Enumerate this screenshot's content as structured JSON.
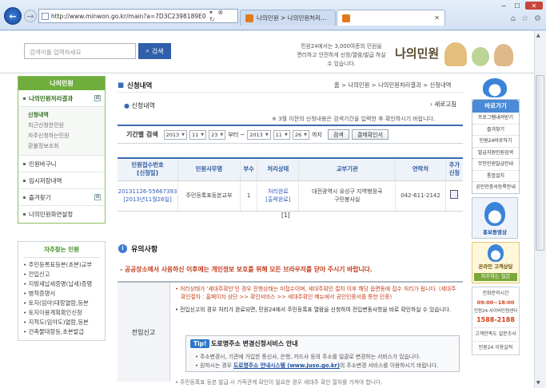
{
  "browser": {
    "url": "http://www.minwon.go.kr/main?a=7D3C2398189E0",
    "tab1": "나의민원 > 나의민원처리...",
    "tab2": "",
    "address_controls": "▾ ⊗ ↻"
  },
  "header": {
    "search_placeholder": "검색어를 입력하세요",
    "search_button": "검색",
    "promo_line1": "민원24에서는 3,000여종의 민원을",
    "promo_line2": "편리하고 안전하게 신청/열람/발급 하실 수 있습니다.",
    "logo": "나의민원"
  },
  "left_nav": {
    "title": "나의민원",
    "items": [
      {
        "label": "나의민원처리결과",
        "toggle": "⊟"
      },
      {
        "label": "민원바구니"
      },
      {
        "label": "임시저장내역"
      },
      {
        "label": "즐겨찾기",
        "toggle": "⊞"
      },
      {
        "label": "나의민원화면설정"
      }
    ],
    "sub_items": [
      "신청내역",
      "최근신청한민원",
      "자주신청하는민원",
      "환불정보조회"
    ]
  },
  "favorites": {
    "title": "자주찾는 민원",
    "items": [
      "주민등록표등본(초본)교부",
      "전입신고",
      "지방세납세증명(납세)증명",
      "병적증명서",
      "토지(임야)대장열람,등본",
      "토지이용계획확인신청",
      "지적도(임야도)열람,등본",
      "건축물대장등,초본발급"
    ]
  },
  "main": {
    "title": "신청내역",
    "breadcrumb": "홈 > 나의민원 > 나의민원처리결과 > 신청내역",
    "subtitle": "신청내역",
    "print": "새로고침",
    "note": "※ 3월 이전의 신청내용은 검색기간을 입력한 후 확인하시기 바랍니다.",
    "filter": {
      "label": "기간별 검색",
      "from_year": "2013",
      "from_month": "11",
      "from_day": "23",
      "sep1": "부터 ~",
      "to_year": "2013",
      "to_month": "11",
      "to_day": "26",
      "sep2": "까지",
      "search_button": "검색",
      "pay_button": "결제확인서"
    },
    "table": {
      "headers": [
        "민원접수번호\n[신청일]",
        "민원사무명",
        "부수",
        "처리상태",
        "교부기관",
        "연락처",
        "추가\n신청"
      ],
      "rows": [
        {
          "receipt_no": "20131126-55667393",
          "date": "[2013년11월26일]",
          "name": "주민등록표등본교부",
          "count": "1",
          "status": "처리완료",
          "status_link": "[출력완료]",
          "agency": "대전광역시 유성구 지역행정국",
          "agency2": "구민봉사실",
          "phone": "042-611-2142"
        }
      ]
    },
    "pager": "[1]"
  },
  "caution": {
    "title": "유의사항",
    "warning": "- 공공장소에서 사용하신 이후에는 개인정보 보호를 위해 모든 브라우저를 닫아 주시기 바랍니다.",
    "row_label": "전입신고",
    "p1": "처리상태가 '세대주확인'인 경우 진행상태는 미접수이며, 세대주확인 절차 이후 해당 읍면동에 접수 처리가 됩니다. (세대주확인절차 : 홈페이지 상단 >> 확인서비스 >> 세대주확인 메뉴에서 공인인증서를 통한 인증)",
    "p2": "전입신고의 경우 처리가 완료되면, 민원24에서 주민등록표 열람을 신청하여 전입변동사항을 바로 확인하실 수 있습니다.",
    "tip_badge": "Tip!",
    "tip_title": "도로명주소 변경신청서비스 안내",
    "tip_l1": "• 주소변경시, 기관에 가입한 통신사, 은행, 카드사 등의 주소를 일괄로 변경하는 서비스가 있습니다.",
    "tip_l2_pre": "• 원하시는 경우 ",
    "tip_l2_link": "도로명주소 안내시스템 (www.juso.go.kr)",
    "tip_l2_post": "의 주소변경 서비스를 이용하시기 바랍니다.",
    "bottom": "• 주민등록표 등본 발급 시 가족관계 확인이 필요한 경우 세대주 확인 절차를 거쳐야 합니다."
  },
  "right_rail": {
    "quick_title": "바로가기",
    "quick_items": [
      "프로그램내려받기",
      "즐겨찾기",
      "민원24바로하기",
      "발급지원민원검색",
      "무인민원발급안내",
      "통합설치",
      "공인인증서등록안내"
    ],
    "promo_video": "홍보동영상",
    "kakao_line1": "온라인 고객상담",
    "kakao_line2": "자주하는 질문",
    "contact_label": "전화문의시간",
    "contact_hours": "09:00~18:00",
    "center_label": "민원24 사이버민원센터",
    "center_number": "1588-2188",
    "survey": "고객만족도 설문조사",
    "guide": "민원24 이용실적"
  }
}
